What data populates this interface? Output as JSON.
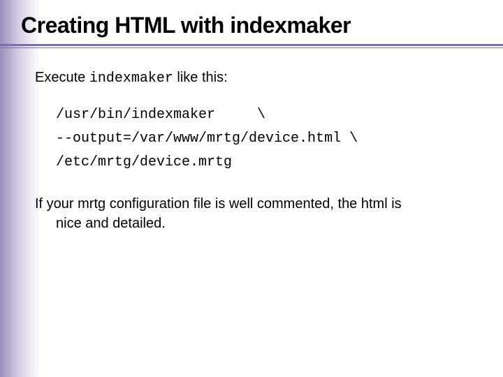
{
  "title": "Creating HTML with indexmaker",
  "intro_prefix": "Execute ",
  "intro_mono": "indexmaker",
  "intro_suffix": " like this:",
  "code_line1": "/usr/bin/indexmaker     \\",
  "code_line2": "--output=/var/www/mrtg/device.html \\",
  "code_line3": "/etc/mrtg/device.mrtg",
  "para_line1": "If your mrtg configuration file is well  commented, the html is",
  "para_line2": "nice and  detailed."
}
